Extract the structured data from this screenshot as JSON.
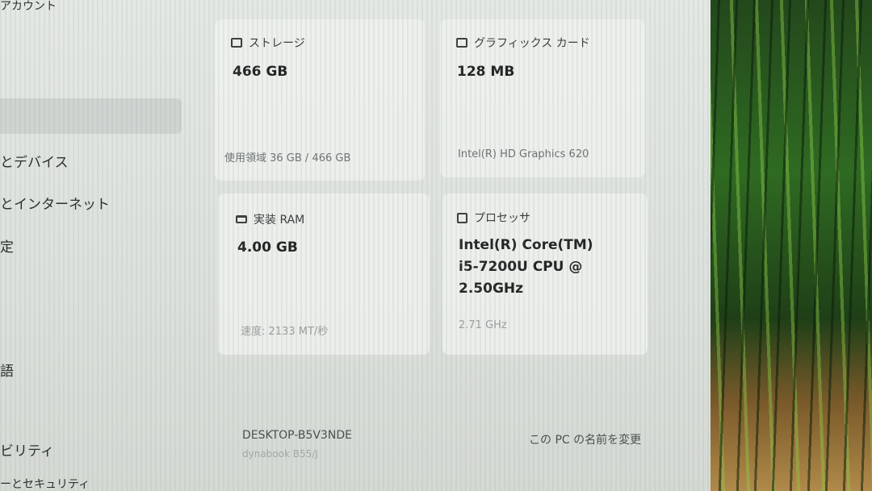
{
  "sidebar": {
    "items": [
      {
        "label": "アカウント"
      },
      {
        "label": "とデバイス"
      },
      {
        "label": "とインターネット"
      },
      {
        "label": "定"
      },
      {
        "label": "語"
      },
      {
        "label": "ビリティ"
      },
      {
        "label": "ーとセキュリティ"
      }
    ]
  },
  "cards": {
    "storage": {
      "title": "ストレージ",
      "value": "466 GB",
      "detail": "使用領域 36 GB / 466 GB",
      "icon": "storage-icon"
    },
    "graphics": {
      "title": "グラフィックス カード",
      "value": "128 MB",
      "detail": "Intel(R) HD Graphics 620",
      "icon": "graphics-card-icon"
    },
    "ram": {
      "title": "実装 RAM",
      "value": "4.00 GB",
      "detail": "速度: 2133 MT/秒",
      "icon": "ram-icon"
    },
    "processor": {
      "title": "プロセッサ",
      "value_lines": [
        "Intel(R) Core(TM)",
        "i5-7200U CPU @",
        "2.50GHz"
      ],
      "detail": "2.71 GHz",
      "icon": "processor-icon"
    }
  },
  "device": {
    "name": "DESKTOP-B5V3NDE",
    "model": "dynabook B55/J"
  },
  "rename_link": "この PC の名前を変更"
}
